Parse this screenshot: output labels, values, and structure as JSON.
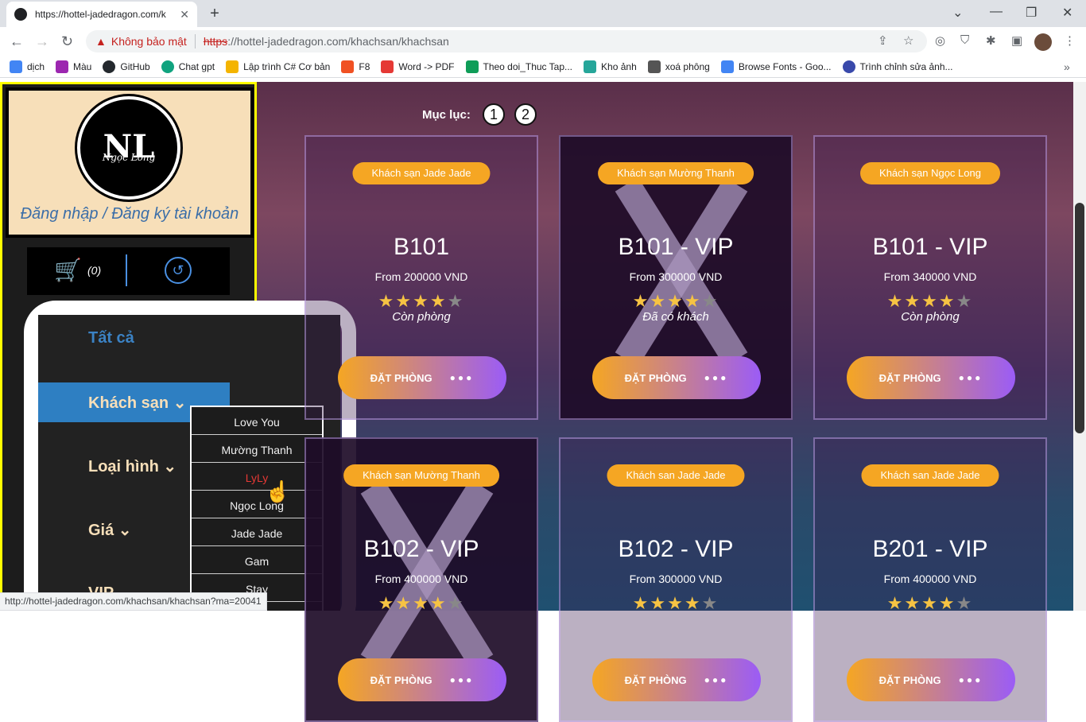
{
  "browser": {
    "tab_title": "https://hottel-jadedragon.com/k",
    "new_tab": "+",
    "security_warning": "Không bảo mật",
    "url_scheme": "https",
    "url_rest": "://hottel-jadedragon.com/khachsan/khachsan",
    "bookmarks": [
      {
        "label": "dịch",
        "color": "#4285f4"
      },
      {
        "label": "Màu",
        "color": "#9c27b0"
      },
      {
        "label": "GitHub",
        "color": "#24292e"
      },
      {
        "label": "Chat gpt",
        "color": "#10a37f"
      },
      {
        "label": "Lập trình C# Cơ bản",
        "color": "#f4b400"
      },
      {
        "label": "F8",
        "color": "#f05123"
      },
      {
        "label": "Word -> PDF",
        "color": "#e53935"
      },
      {
        "label": "Theo doi_Thuc Tap...",
        "color": "#0f9d58"
      },
      {
        "label": "Kho ảnh",
        "color": "#26a69a"
      },
      {
        "label": "xoá phông",
        "color": "#555555"
      },
      {
        "label": "Browse Fonts - Goo...",
        "color": "#4285f4"
      },
      {
        "label": "Trình chỉnh sửa ảnh...",
        "color": "#3949ab"
      }
    ],
    "status_url": "http://hottel-jadedragon.com/khachsan/khachsan?ma=20041"
  },
  "sidebar": {
    "logo_initials": "NL",
    "logo_name": "Ngọc Long",
    "login_text": "Đăng nhập / Đăng ký tài khoản",
    "cart_count": "(0)",
    "menu": [
      {
        "label": "Tất cả"
      },
      {
        "label": "Khách sạn ⌄"
      },
      {
        "label": "Loại hình ⌄"
      },
      {
        "label": "Giá ⌄"
      },
      {
        "label": "VIP ⌄"
      }
    ],
    "hotel_dropdown": [
      "Love You",
      "Mường Thanh",
      "LyLy",
      "Ngọc Long",
      "Jade Jade",
      "Gam",
      "Stay"
    ]
  },
  "pagination": {
    "label": "Mục lục:",
    "pages": [
      "1",
      "2"
    ]
  },
  "rooms": [
    {
      "hotel": "Khách sạn Jade Jade",
      "room": "B101",
      "price": "From 200000 VND",
      "rating": 4,
      "status": "Còn phòng",
      "booked": false
    },
    {
      "hotel": "Khách sạn Mường Thanh",
      "room": "B101 - VIP",
      "price": "From 300000 VND",
      "rating": 4,
      "status": "Đã có khách",
      "booked": true
    },
    {
      "hotel": "Khách sạn Ngọc Long",
      "room": "B101 - VIP",
      "price": "From 340000 VND",
      "rating": 4,
      "status": "Còn phòng",
      "booked": false
    },
    {
      "hotel": "Khách sạn Mường Thanh",
      "room": "B102 - VIP",
      "price": "From 400000 VND",
      "rating": 4,
      "status": "",
      "booked": true
    },
    {
      "hotel": "Khách san Jade Jade",
      "room": "B102 - VIP",
      "price": "From 300000 VND",
      "rating": 4,
      "status": "",
      "booked": false
    },
    {
      "hotel": "Khách san Jade Jade",
      "room": "B201 - VIP",
      "price": "From 400000 VND",
      "rating": 4,
      "status": "",
      "booked": false
    }
  ],
  "book_label": "ĐẶT PHÒNG",
  "book_dots": "●●●"
}
